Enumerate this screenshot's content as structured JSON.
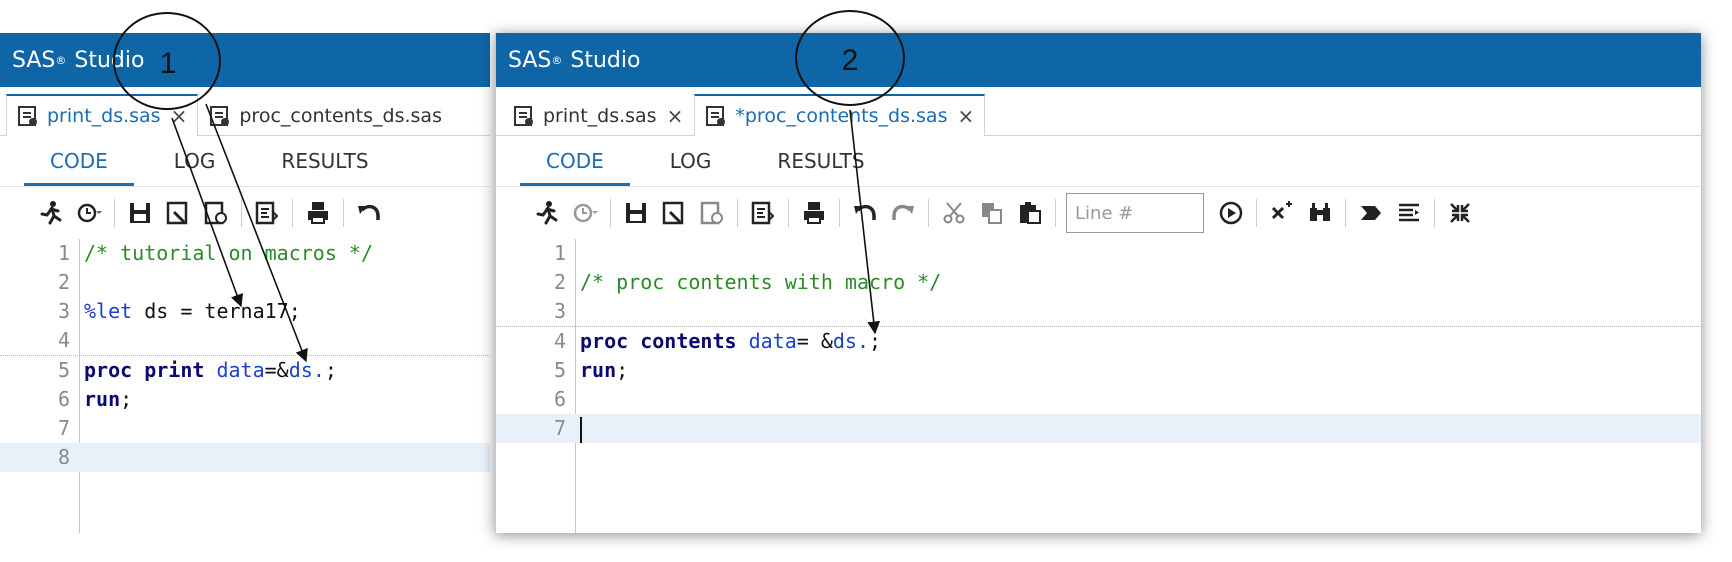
{
  "panel1": {
    "app_title": "SAS",
    "app_title_suffix": "Studio",
    "tabs": [
      {
        "label": "print_ds.sas",
        "close": "×",
        "active": true
      },
      {
        "label": "proc_contents_ds.sas",
        "active": false
      }
    ],
    "subtabs": [
      "CODE",
      "LOG",
      "RESULTS"
    ],
    "lines": [
      {
        "n": "1",
        "parts": [
          {
            "t": "/* tutorial on macros */",
            "c": "c-com"
          }
        ]
      },
      {
        "n": "2",
        "parts": []
      },
      {
        "n": "3",
        "parts": [
          {
            "t": "%let",
            "c": "c-mac"
          },
          {
            "t": " ds = terna17;",
            "c": ""
          }
        ]
      },
      {
        "n": "4",
        "parts": []
      },
      {
        "n": "5",
        "parts": [
          {
            "t": "proc print",
            "c": "c-kw"
          },
          {
            "t": " ",
            "c": ""
          },
          {
            "t": "data",
            "c": "c-opt"
          },
          {
            "t": "=&",
            "c": ""
          },
          {
            "t": "ds.",
            "c": "c-var"
          },
          {
            "t": ";",
            "c": ""
          }
        ]
      },
      {
        "n": "6",
        "parts": [
          {
            "t": "run",
            "c": "c-kw"
          },
          {
            "t": ";",
            "c": ""
          }
        ]
      },
      {
        "n": "7",
        "parts": []
      },
      {
        "n": "8",
        "parts": []
      }
    ]
  },
  "panel2": {
    "app_title": "SAS",
    "app_title_suffix": "Studio",
    "tabs": [
      {
        "label": "print_ds.sas",
        "close": "×",
        "active": false
      },
      {
        "label": "*proc_contents_ds.sas",
        "close": "×",
        "active": true
      }
    ],
    "subtabs": [
      "CODE",
      "LOG",
      "RESULTS"
    ],
    "line_input_placeholder": "Line #",
    "lines": [
      {
        "n": "1",
        "parts": []
      },
      {
        "n": "2",
        "parts": [
          {
            "t": "/* proc contents with macro */",
            "c": "c-com"
          }
        ]
      },
      {
        "n": "3",
        "parts": []
      },
      {
        "n": "4",
        "parts": [
          {
            "t": "proc contents",
            "c": "c-kw"
          },
          {
            "t": " ",
            "c": ""
          },
          {
            "t": "data",
            "c": "c-opt"
          },
          {
            "t": "= &",
            "c": ""
          },
          {
            "t": "ds.",
            "c": "c-var"
          },
          {
            "t": ";",
            "c": ""
          }
        ]
      },
      {
        "n": "5",
        "parts": [
          {
            "t": "run",
            "c": "c-kw"
          },
          {
            "t": ";",
            "c": ""
          }
        ]
      },
      {
        "n": "6",
        "parts": []
      },
      {
        "n": "7",
        "parts": []
      }
    ]
  },
  "annotations": {
    "label1": "1",
    "label2": "2"
  },
  "colors": {
    "title_bar": "#0f66a6",
    "accent": "#1a6cb4",
    "comment": "#2d8a28",
    "keyword": "#0a0a70",
    "macro": "#1c3fd0"
  }
}
